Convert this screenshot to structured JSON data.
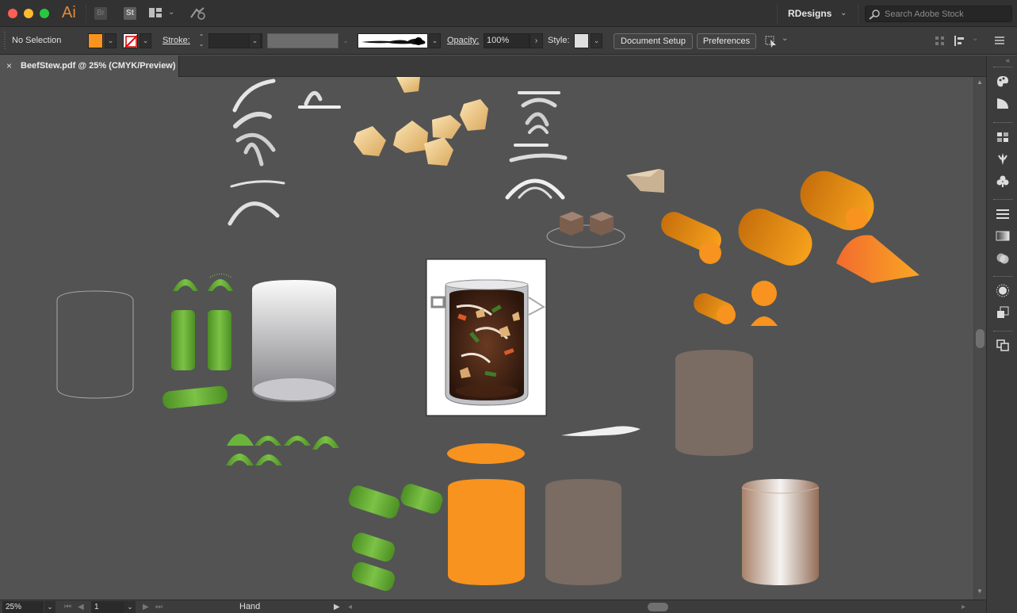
{
  "window": {
    "app_logo": "Ai",
    "bridge_label": "Br",
    "stock_label": "St",
    "workspace": "RDesigns",
    "search_placeholder": "Search Adobe Stock"
  },
  "control_bar": {
    "selection_label": "No Selection",
    "fill_color": "#f7931e",
    "stroke_label": "Stroke:",
    "opacity_label": "Opacity:",
    "opacity_value": "100%",
    "style_label": "Style:",
    "document_setup_label": "Document Setup",
    "preferences_label": "Preferences"
  },
  "document_tab": {
    "close_glyph": "×",
    "title": "BeefStew.pdf @ 25% (CMYK/Preview)"
  },
  "status_bar": {
    "zoom": "25%",
    "page": "1",
    "current_tool": "Hand"
  },
  "colors": {
    "accent_orange": "#f7931e",
    "celery_green": "#6ab43e",
    "beef_brown": "#7a6b63",
    "canvas_bg": "#535353"
  },
  "right_panel_icons": [
    "color-icon",
    "color-guide-icon",
    "swatches-icon",
    "brushes-icon",
    "symbols-icon",
    "stroke-icon",
    "gradient-icon",
    "transparency-icon",
    "appearance-icon",
    "graphic-styles-icon",
    "layers-icon"
  ]
}
